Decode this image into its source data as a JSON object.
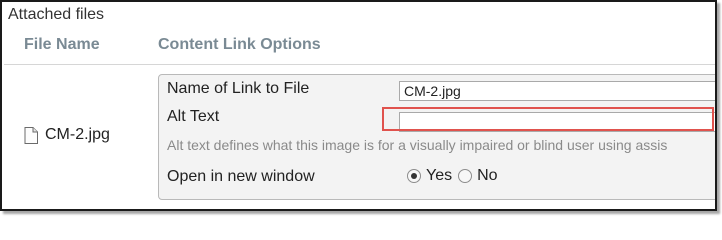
{
  "section": {
    "title": "Attached files"
  },
  "columns": {
    "file_name": "File Name",
    "content_link_options": "Content Link Options"
  },
  "file": {
    "name": "CM-2.jpg",
    "icon": "document-icon"
  },
  "options": {
    "link_name_label": "Name of Link to File",
    "link_name_value": "CM-2.jpg",
    "alt_text_label": "Alt Text",
    "alt_text_value": "",
    "alt_text_helper": "Alt text defines what this image is for a visually impaired or blind user using assis",
    "new_window_label": "Open in new window",
    "new_window_options": [
      "Yes",
      "No"
    ],
    "new_window_selected": "Yes"
  },
  "colors": {
    "highlight": "#e0524d",
    "column_header": "#7a8a94",
    "panel_bg": "#f3f3f3"
  }
}
